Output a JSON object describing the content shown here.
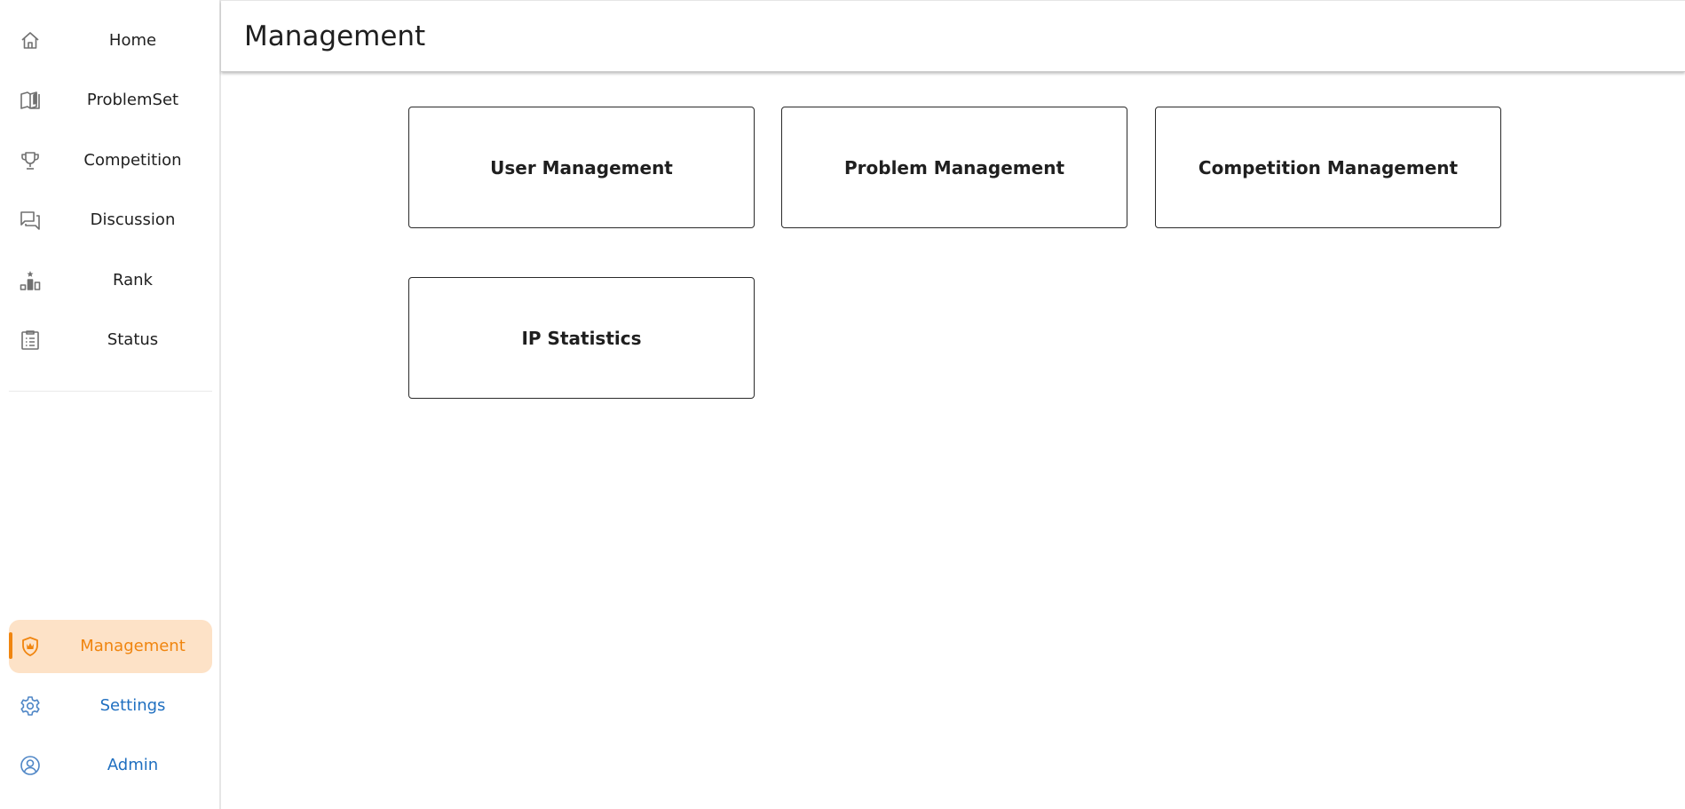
{
  "header": {
    "title": "Management"
  },
  "sidebar": {
    "items": [
      {
        "label": "Home",
        "icon": "home-icon"
      },
      {
        "label": "ProblemSet",
        "icon": "book-icon"
      },
      {
        "label": "Competition",
        "icon": "trophy-icon"
      },
      {
        "label": "Discussion",
        "icon": "chat-icon"
      },
      {
        "label": "Rank",
        "icon": "podium-icon"
      },
      {
        "label": "Status",
        "icon": "clipboard-icon"
      }
    ],
    "bottom_items": [
      {
        "label": "Management",
        "icon": "shield-crown-icon",
        "active": true
      },
      {
        "label": "Settings",
        "icon": "gear-icon"
      },
      {
        "label": "Admin",
        "icon": "user-circle-icon"
      }
    ]
  },
  "cards": [
    {
      "label": "User Management"
    },
    {
      "label": "Problem Management"
    },
    {
      "label": "Competition Management"
    },
    {
      "label": "IP Statistics"
    }
  ],
  "colors": {
    "accent": "#f0850f",
    "active_bg": "#fde2c7",
    "link_blue": "#1f6fc0"
  }
}
